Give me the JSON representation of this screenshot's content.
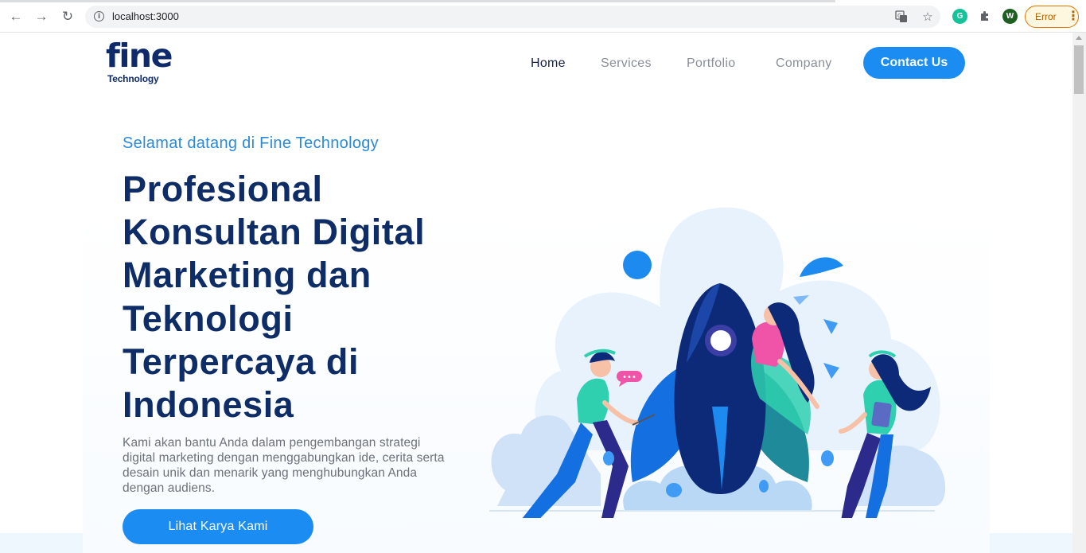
{
  "browser": {
    "url": "localhost:3000",
    "extension_badge_letter": "W",
    "error_label": "Error",
    "icons": [
      "back-icon",
      "forward-icon",
      "reload-icon",
      "info-icon",
      "translate-icon",
      "bookmark-star-icon",
      "grammarly-icon",
      "extensions-puzzle-icon",
      "profile-avatar",
      "kebab-menu-icon"
    ]
  },
  "header": {
    "logo_word": "fine",
    "logo_sub": "Technology",
    "nav": [
      {
        "label": "Home",
        "active": true
      },
      {
        "label": "Services",
        "active": false
      },
      {
        "label": "Portfolio",
        "active": false
      },
      {
        "label": "Company",
        "active": false
      }
    ],
    "contact_label": "Contact Us"
  },
  "hero": {
    "welcome": "Selamat datang di Fine Technology",
    "headline": "Profesional Konsultan Digital Marketing dan Teknologi Terpercaya di Indonesia",
    "description": "Kami akan bantu Anda dalam pengembangan strategi digital marketing dengan menggabungkan ide, cerita serta desain unik dan menarik yang menghubungkan Anda dengan audiens.",
    "cta_label": "Lihat Karya Kami",
    "illustration_bubble": "•••"
  },
  "colors": {
    "primary": "#1b8cf2",
    "navy": "#0e2c66",
    "welcome_blue": "#2b89d8",
    "rocket": "#0d2a78"
  }
}
